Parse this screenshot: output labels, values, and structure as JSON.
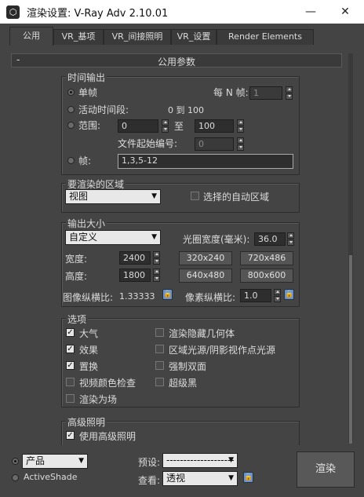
{
  "window": {
    "title": "渲染设置: V-Ray Adv 2.10.01",
    "icon": "3ds-max-logo",
    "minimize": "—",
    "close": "✕"
  },
  "tabs": [
    {
      "label": "公用"
    },
    {
      "label": "VR_基项"
    },
    {
      "label": "VR_间接照明"
    },
    {
      "label": "VR_设置"
    },
    {
      "label": "Render Elements"
    }
  ],
  "rollout": {
    "toggle": "-",
    "title": "公用参数"
  },
  "time_output": {
    "title": "时间输出",
    "single": "单帧",
    "every_n_label": "每 N 帧:",
    "every_n_value": "1",
    "active_segment": "活动时间段:",
    "active_range": "0 到 100",
    "range": "范围:",
    "range_from": "0",
    "range_to_label": "至",
    "range_to": "100",
    "file_start_label": "文件起始编号:",
    "file_start_value": "0",
    "frames": "帧:",
    "frames_value": "1,3,5-12"
  },
  "area": {
    "title": "要渲染的区域",
    "value": "视图",
    "auto_region": "选择的自动区域"
  },
  "output_size": {
    "title": "输出大小",
    "preset": "自定义",
    "aperture_label": "光圈宽度(毫米):",
    "aperture_value": "36.0",
    "width_label": "宽度:",
    "width_value": "2400",
    "height_label": "高度:",
    "height_value": "1800",
    "presets": [
      "320x240",
      "720x486",
      "640x480",
      "800x600"
    ],
    "image_aspect_label": "图像纵横比:",
    "image_aspect_value": "1.33333",
    "pixel_aspect_label": "像素纵横比:",
    "pixel_aspect_value": "1.0"
  },
  "options": {
    "title": "选项",
    "left": [
      {
        "label": "大气",
        "checked": true
      },
      {
        "label": "效果",
        "checked": true
      },
      {
        "label": "置换",
        "checked": true
      },
      {
        "label": "视频颜色检查",
        "checked": false
      },
      {
        "label": "渲染为场",
        "checked": false
      }
    ],
    "right": [
      {
        "label": "渲染隐藏几何体",
        "checked": false
      },
      {
        "label": "区域光源/阴影视作点光源",
        "checked": false
      },
      {
        "label": "强制双面",
        "checked": false
      },
      {
        "label": "超级黑",
        "checked": false
      }
    ]
  },
  "advanced_lighting": {
    "title": "高级照明",
    "use": "使用高级照明",
    "checked": true
  },
  "bottom": {
    "mode_product": "产品",
    "mode_activeshade": "ActiveShade",
    "preset_label": "预设:",
    "preset_value": "--------------------",
    "view_label": "查看:",
    "view_value": "透视",
    "render": "渲染"
  }
}
